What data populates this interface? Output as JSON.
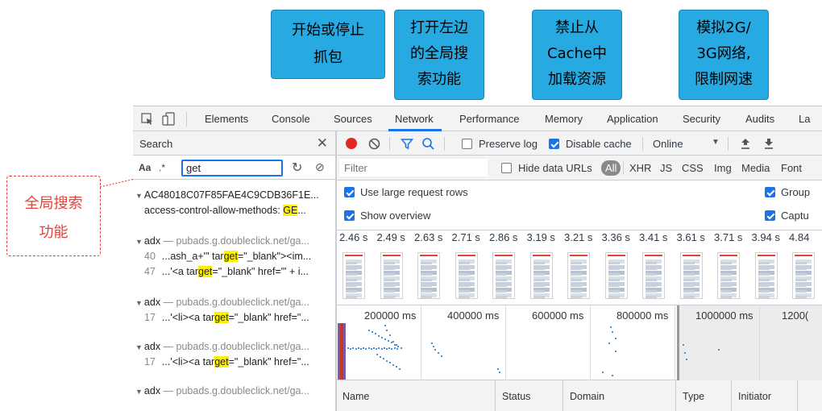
{
  "callouts": {
    "record": "开始或停止\n抓包",
    "search": "打开左边\n的全局搜\n索功能",
    "cache": "禁止从\nCache中\n加载资源",
    "throttle": "模拟2G/\n3G网络,\n限制网速"
  },
  "side_annotation": "全局搜索\n功能",
  "tabs": [
    "Elements",
    "Console",
    "Sources",
    "Network",
    "Performance",
    "Memory",
    "Application",
    "Security",
    "Audits",
    "La"
  ],
  "active_tab": "Network",
  "search_pane": {
    "title": "Search",
    "case_label": "Aa",
    "regex_label": ".*",
    "query": "get",
    "results": [
      {
        "file": "AC48018C07F85FAE4C9CDB36F1E...",
        "url": "",
        "lines": [
          {
            "num": "",
            "pre": "access-control-allow-methods: ",
            "match": "GE",
            "post": "..."
          }
        ]
      },
      {
        "file": "adx",
        "url": " — pubads.g.doubleclick.net/ga...",
        "lines": [
          {
            "num": "40",
            "pre": "...ash_a+'\" tar",
            "match": "get",
            "post": "=\"_blank\"><im..."
          },
          {
            "num": "47",
            "pre": "...'<a tar",
            "match": "get",
            "post": "=\"_blank\" href=\"' + i..."
          }
        ]
      },
      {
        "file": "adx",
        "url": " — pubads.g.doubleclick.net/ga...",
        "lines": [
          {
            "num": "17",
            "pre": "...'<li><a tar",
            "match": "get",
            "post": "=\"_blank\" href=\"..."
          }
        ]
      },
      {
        "file": "adx",
        "url": " — pubads.g.doubleclick.net/ga...",
        "lines": [
          {
            "num": "17",
            "pre": "...'<li><a tar",
            "match": "get",
            "post": "=\"_blank\" href=\"..."
          }
        ]
      },
      {
        "file": "adx",
        "url": " — pubads.g.doubleclick.net/ga...",
        "lines": []
      }
    ]
  },
  "toolbar": {
    "preserve_log": "Preserve log",
    "preserve_log_checked": false,
    "disable_cache": "Disable cache",
    "disable_cache_checked": true,
    "throttle": "Online"
  },
  "filter_row": {
    "placeholder": "Filter",
    "hide_data_urls": "Hide data URLs",
    "types": [
      "All",
      "XHR",
      "JS",
      "CSS",
      "Img",
      "Media",
      "Font"
    ]
  },
  "settings": {
    "large_rows": "Use large request rows",
    "overview": "Show overview",
    "group": "Group",
    "capture": "Captu"
  },
  "frame_times": [
    "2.46 s",
    "2.49 s",
    "2.63 s",
    "2.71 s",
    "2.86 s",
    "3.19 s",
    "3.21 s",
    "3.36 s",
    "3.41 s",
    "3.61 s",
    "3.71 s",
    "3.94 s",
    "4.84"
  ],
  "overview_labels": [
    "200000 ms",
    "400000 ms",
    "600000 ms",
    "800000 ms",
    "1000000 ms",
    "1200("
  ],
  "table_headers": [
    "Name",
    "Status",
    "Domain",
    "Type",
    "Initiator"
  ],
  "colors": {
    "accent": "#1a73e8",
    "record": "#e3261f",
    "highlight": "#fff200",
    "callout": "#27a9e1",
    "annotation": "#e4423b"
  }
}
